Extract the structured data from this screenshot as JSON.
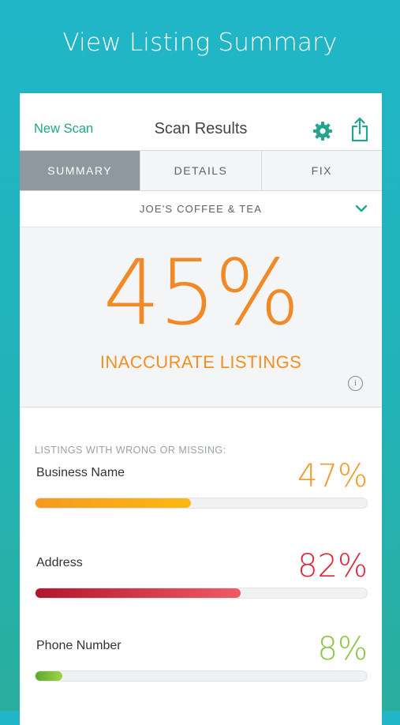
{
  "headline": "View Listing Summary",
  "navbar": {
    "left_label": "New Scan",
    "title": "Scan Results",
    "accent": "#21a58e"
  },
  "tabs": [
    {
      "label": "SUMMARY",
      "active": true
    },
    {
      "label": "DETAILS",
      "active": false
    },
    {
      "label": "FIX",
      "active": false
    }
  ],
  "business_name": "JOE'S COFFEE & TEA",
  "summary": {
    "percent": "45%",
    "label": "INACCURATE LISTINGS",
    "info_glyph": "i",
    "color": "#f08a28"
  },
  "listings": {
    "heading": "LISTINGS WITH WRONG OR MISSING:",
    "items": [
      {
        "label": "Business Name",
        "percent": "47%",
        "color": "#f39a2a"
      },
      {
        "label": "Address",
        "percent": "82%",
        "color": "#e0283a"
      },
      {
        "label": "Phone Number",
        "percent": "8%",
        "color": "#8cc63f"
      }
    ]
  }
}
